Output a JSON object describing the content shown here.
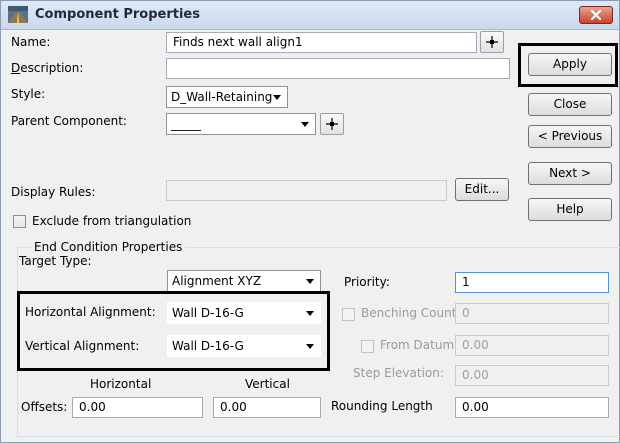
{
  "window": {
    "title": "Component Properties"
  },
  "fields": {
    "name_label": "Name:",
    "name_value": "Finds next wall align1",
    "description_label_first": "D",
    "description_label_rest": "escription:",
    "description_value": "",
    "style_label": "Style:",
    "style_value": "D_Wall-Retaining",
    "parent_label": "Parent Component:",
    "parent_value": "_____",
    "display_rules_label": "Display Rules:",
    "display_rules_value": "",
    "edit_button": "Edit...",
    "exclude_label": "Exclude from triangulation",
    "exclude_checked": false
  },
  "buttons": {
    "apply": "Apply",
    "close": "Close",
    "previous": "< Previous",
    "next": "Next >",
    "help": "Help"
  },
  "end_condition": {
    "group_label": "End Condition Properties",
    "target_type_label": "Target Type:",
    "target_type_value": "Alignment XYZ",
    "horizontal_alignment_label": "Horizontal Alignment:",
    "horizontal_alignment_value": "Wall D-16-G",
    "vertical_alignment_label": "Vertical Alignment:",
    "vertical_alignment_value": "Wall D-16-G",
    "priority_label": "Priority:",
    "priority_value": "1",
    "benching_count_label": "Benching Count:",
    "benching_count_value": "0",
    "from_datum_label": "From Datum:",
    "from_datum_value": "0.00",
    "step_elevation_label": "Step Elevation:",
    "step_elevation_value": "0.00",
    "horizontal_col": "Horizontal",
    "vertical_col": "Vertical",
    "offsets_label": "Offsets:",
    "offset_horizontal": "0.00",
    "offset_vertical": "0.00",
    "rounding_length_label": "Rounding Length",
    "rounding_length_value": "0.00"
  }
}
